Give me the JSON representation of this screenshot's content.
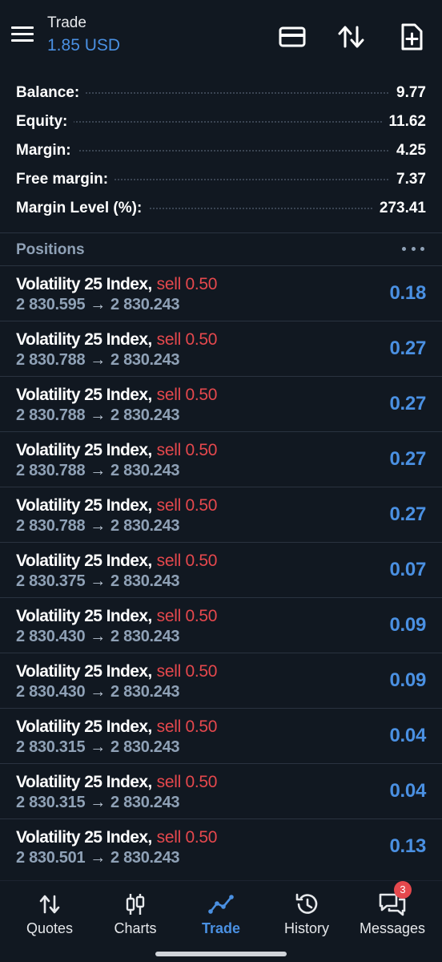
{
  "header": {
    "title": "Trade",
    "subtitle": "1.85 USD",
    "icons": [
      "menu-icon",
      "card-icon",
      "sort-arrows-icon",
      "new-document-icon"
    ]
  },
  "summary": [
    {
      "label": "Balance:",
      "value": "9.77"
    },
    {
      "label": "Equity:",
      "value": "11.62"
    },
    {
      "label": "Margin:",
      "value": "4.25"
    },
    {
      "label": "Free margin:",
      "value": "7.37"
    },
    {
      "label": "Margin Level (%):",
      "value": "273.41"
    }
  ],
  "positions_title": "Positions",
  "positions": [
    {
      "symbol": "Volatility 25 Index,",
      "side": "sell 0.50",
      "open": "2 830.595",
      "arrow": "→",
      "current": "2 830.243",
      "profit": "0.18"
    },
    {
      "symbol": "Volatility 25 Index,",
      "side": "sell 0.50",
      "open": "2 830.788",
      "arrow": "→",
      "current": "2 830.243",
      "profit": "0.27"
    },
    {
      "symbol": "Volatility 25 Index,",
      "side": "sell 0.50",
      "open": "2 830.788",
      "arrow": "→",
      "current": "2 830.243",
      "profit": "0.27"
    },
    {
      "symbol": "Volatility 25 Index,",
      "side": "sell 0.50",
      "open": "2 830.788",
      "arrow": "→",
      "current": "2 830.243",
      "profit": "0.27"
    },
    {
      "symbol": "Volatility 25 Index,",
      "side": "sell 0.50",
      "open": "2 830.788",
      "arrow": "→",
      "current": "2 830.243",
      "profit": "0.27"
    },
    {
      "symbol": "Volatility 25 Index,",
      "side": "sell 0.50",
      "open": "2 830.375",
      "arrow": "→",
      "current": "2 830.243",
      "profit": "0.07"
    },
    {
      "symbol": "Volatility 25 Index,",
      "side": "sell 0.50",
      "open": "2 830.430",
      "arrow": "→",
      "current": "2 830.243",
      "profit": "0.09"
    },
    {
      "symbol": "Volatility 25 Index,",
      "side": "sell 0.50",
      "open": "2 830.430",
      "arrow": "→",
      "current": "2 830.243",
      "profit": "0.09"
    },
    {
      "symbol": "Volatility 25 Index,",
      "side": "sell 0.50",
      "open": "2 830.315",
      "arrow": "→",
      "current": "2 830.243",
      "profit": "0.04"
    },
    {
      "symbol": "Volatility 25 Index,",
      "side": "sell 0.50",
      "open": "2 830.315",
      "arrow": "→",
      "current": "2 830.243",
      "profit": "0.04"
    },
    {
      "symbol": "Volatility 25 Index,",
      "side": "sell 0.50",
      "open": "2 830.501",
      "arrow": "→",
      "current": "2 830.243",
      "profit": "0.13"
    }
  ],
  "nav": [
    {
      "label": "Quotes",
      "icon": "quotes-arrows-icon",
      "active": false
    },
    {
      "label": "Charts",
      "icon": "candlestick-icon",
      "active": false
    },
    {
      "label": "Trade",
      "icon": "trend-line-icon",
      "active": true
    },
    {
      "label": "History",
      "icon": "history-clock-icon",
      "active": false
    },
    {
      "label": "Messages",
      "icon": "chat-bubbles-icon",
      "active": false,
      "badge": "3"
    }
  ],
  "colors": {
    "background": "#111821",
    "accent": "#4a90e2",
    "sell": "#e5484d",
    "muted": "#8fa1b6"
  }
}
